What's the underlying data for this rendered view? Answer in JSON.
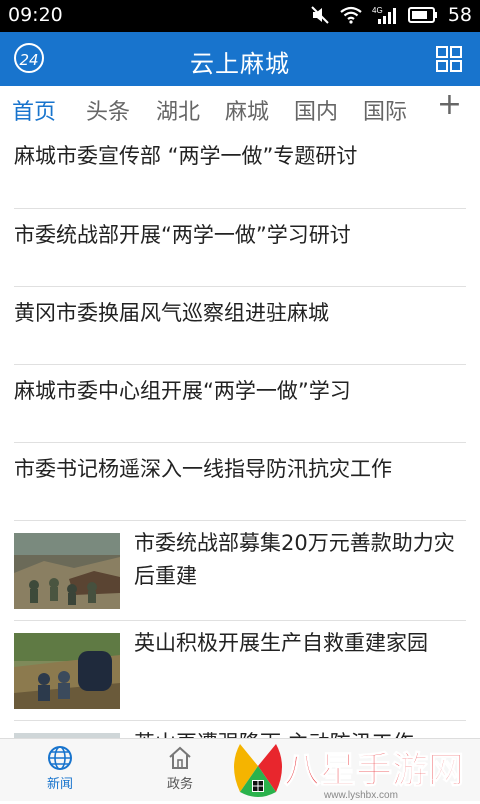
{
  "status_bar": {
    "time": "09:20",
    "battery": "58",
    "network": "4G"
  },
  "header": {
    "logo_text": "24",
    "title": "云上麻城"
  },
  "tabs": [
    {
      "label": "首页",
      "active": true
    },
    {
      "label": "头条"
    },
    {
      "label": "湖北"
    },
    {
      "label": "麻城"
    },
    {
      "label": "国内"
    },
    {
      "label": "国际"
    }
  ],
  "tab_add_label": "+",
  "news": [
    {
      "title": "麻城市委宣传部 “两学一做”专题研讨"
    },
    {
      "title": "市委统战部开展“两学一做”学习研讨"
    },
    {
      "title": "黄冈市委换届风气巡察组进驻麻城"
    },
    {
      "title": "麻城市委中心组开展“两学一做”学习"
    },
    {
      "title": "市委书记杨遥深入一线指导防汛抗灾工作"
    }
  ],
  "image_news": [
    {
      "title": "市委统战部募集20万元善款助力灾后重建"
    },
    {
      "title": "英山积极开展生产自救重建家园"
    },
    {
      "title": "英山再遭强降雨 主动防汛工作"
    }
  ],
  "bottom_nav": [
    {
      "label": "新闻",
      "icon": "globe-icon",
      "active": true
    },
    {
      "label": "政务",
      "icon": "home-icon"
    }
  ],
  "watermark": {
    "text": "八星手游网",
    "url": "www.lyshbx.com"
  },
  "colors": {
    "brand": "#1874cd",
    "text": "#222222",
    "divider": "#e0e0e0"
  }
}
